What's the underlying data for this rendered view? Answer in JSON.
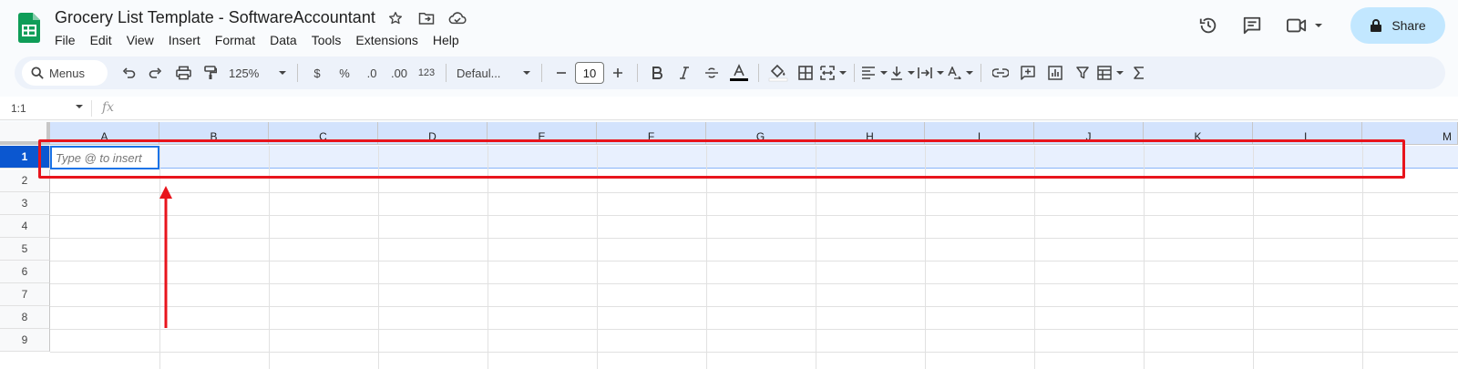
{
  "window": {
    "doc_title": "Grocery List Template - SoftwareAccountant",
    "icons": [
      "star-icon",
      "move-to-folder-icon",
      "cloud-status-icon"
    ]
  },
  "menu": [
    "File",
    "Edit",
    "View",
    "Insert",
    "Format",
    "Data",
    "Tools",
    "Extensions",
    "Help"
  ],
  "actions": {
    "share_label": "Share"
  },
  "toolbar": {
    "search_label": "Menus",
    "zoom": "125%",
    "currency": "$",
    "percent": "%",
    "decrease_decimal": ".0",
    "increase_decimal": ".00",
    "number_format": "123",
    "font_family": "Defaul...",
    "font_size": "10"
  },
  "formula_bar": {
    "name_box": "1:1",
    "fx": "fx"
  },
  "sheet": {
    "columns": [
      "A",
      "B",
      "C",
      "D",
      "E",
      "F",
      "G",
      "H",
      "I",
      "J",
      "K",
      "L",
      "M"
    ],
    "rows": [
      "1",
      "2",
      "3",
      "4",
      "5",
      "6",
      "7",
      "8",
      "9"
    ],
    "active_cell_placeholder": "Type @ to insert"
  },
  "colors": {
    "accent": "#0b57d0",
    "share_bg": "#c2e7ff",
    "annotation": "#e8141c",
    "selection_bg": "#e8f0fe"
  }
}
